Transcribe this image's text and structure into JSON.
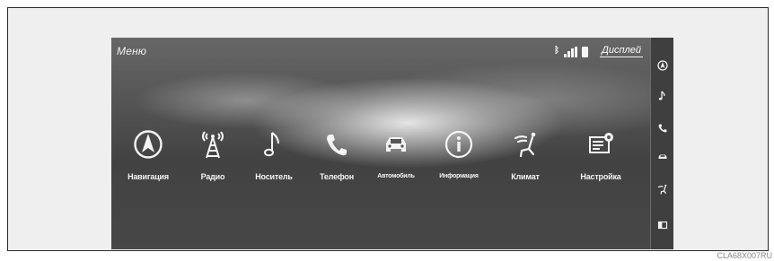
{
  "header": {
    "title": "Меню",
    "bluetooth_icon": "bluetooth-icon",
    "display_button_label": "Дисплей"
  },
  "apps": [
    {
      "label": "Навигация",
      "icon": "navigation-icon"
    },
    {
      "label": "Радио",
      "icon": "radio-tower-icon"
    },
    {
      "label": "Носитель",
      "icon": "music-note-icon"
    },
    {
      "label": "Телефон",
      "icon": "phone-icon"
    },
    {
      "label": "Автомобиль",
      "icon": "car-icon"
    },
    {
      "label": "Информация",
      "icon": "info-icon"
    },
    {
      "label": "Климат",
      "icon": "climate-seat-icon"
    },
    {
      "label": "Настройка",
      "icon": "setup-icon"
    }
  ],
  "side_panel": {
    "icons": [
      "navigation-icon",
      "music-note-icon",
      "phone-icon",
      "car-icon",
      "climate-seat-icon",
      "screen-icon"
    ]
  },
  "caption": "CLA68X007RU",
  "colors": {
    "screen_dark": "#474747",
    "screen_light": "#e8e8e8",
    "text": "#f4f4f4",
    "frame_border": "#2a2a2a"
  }
}
